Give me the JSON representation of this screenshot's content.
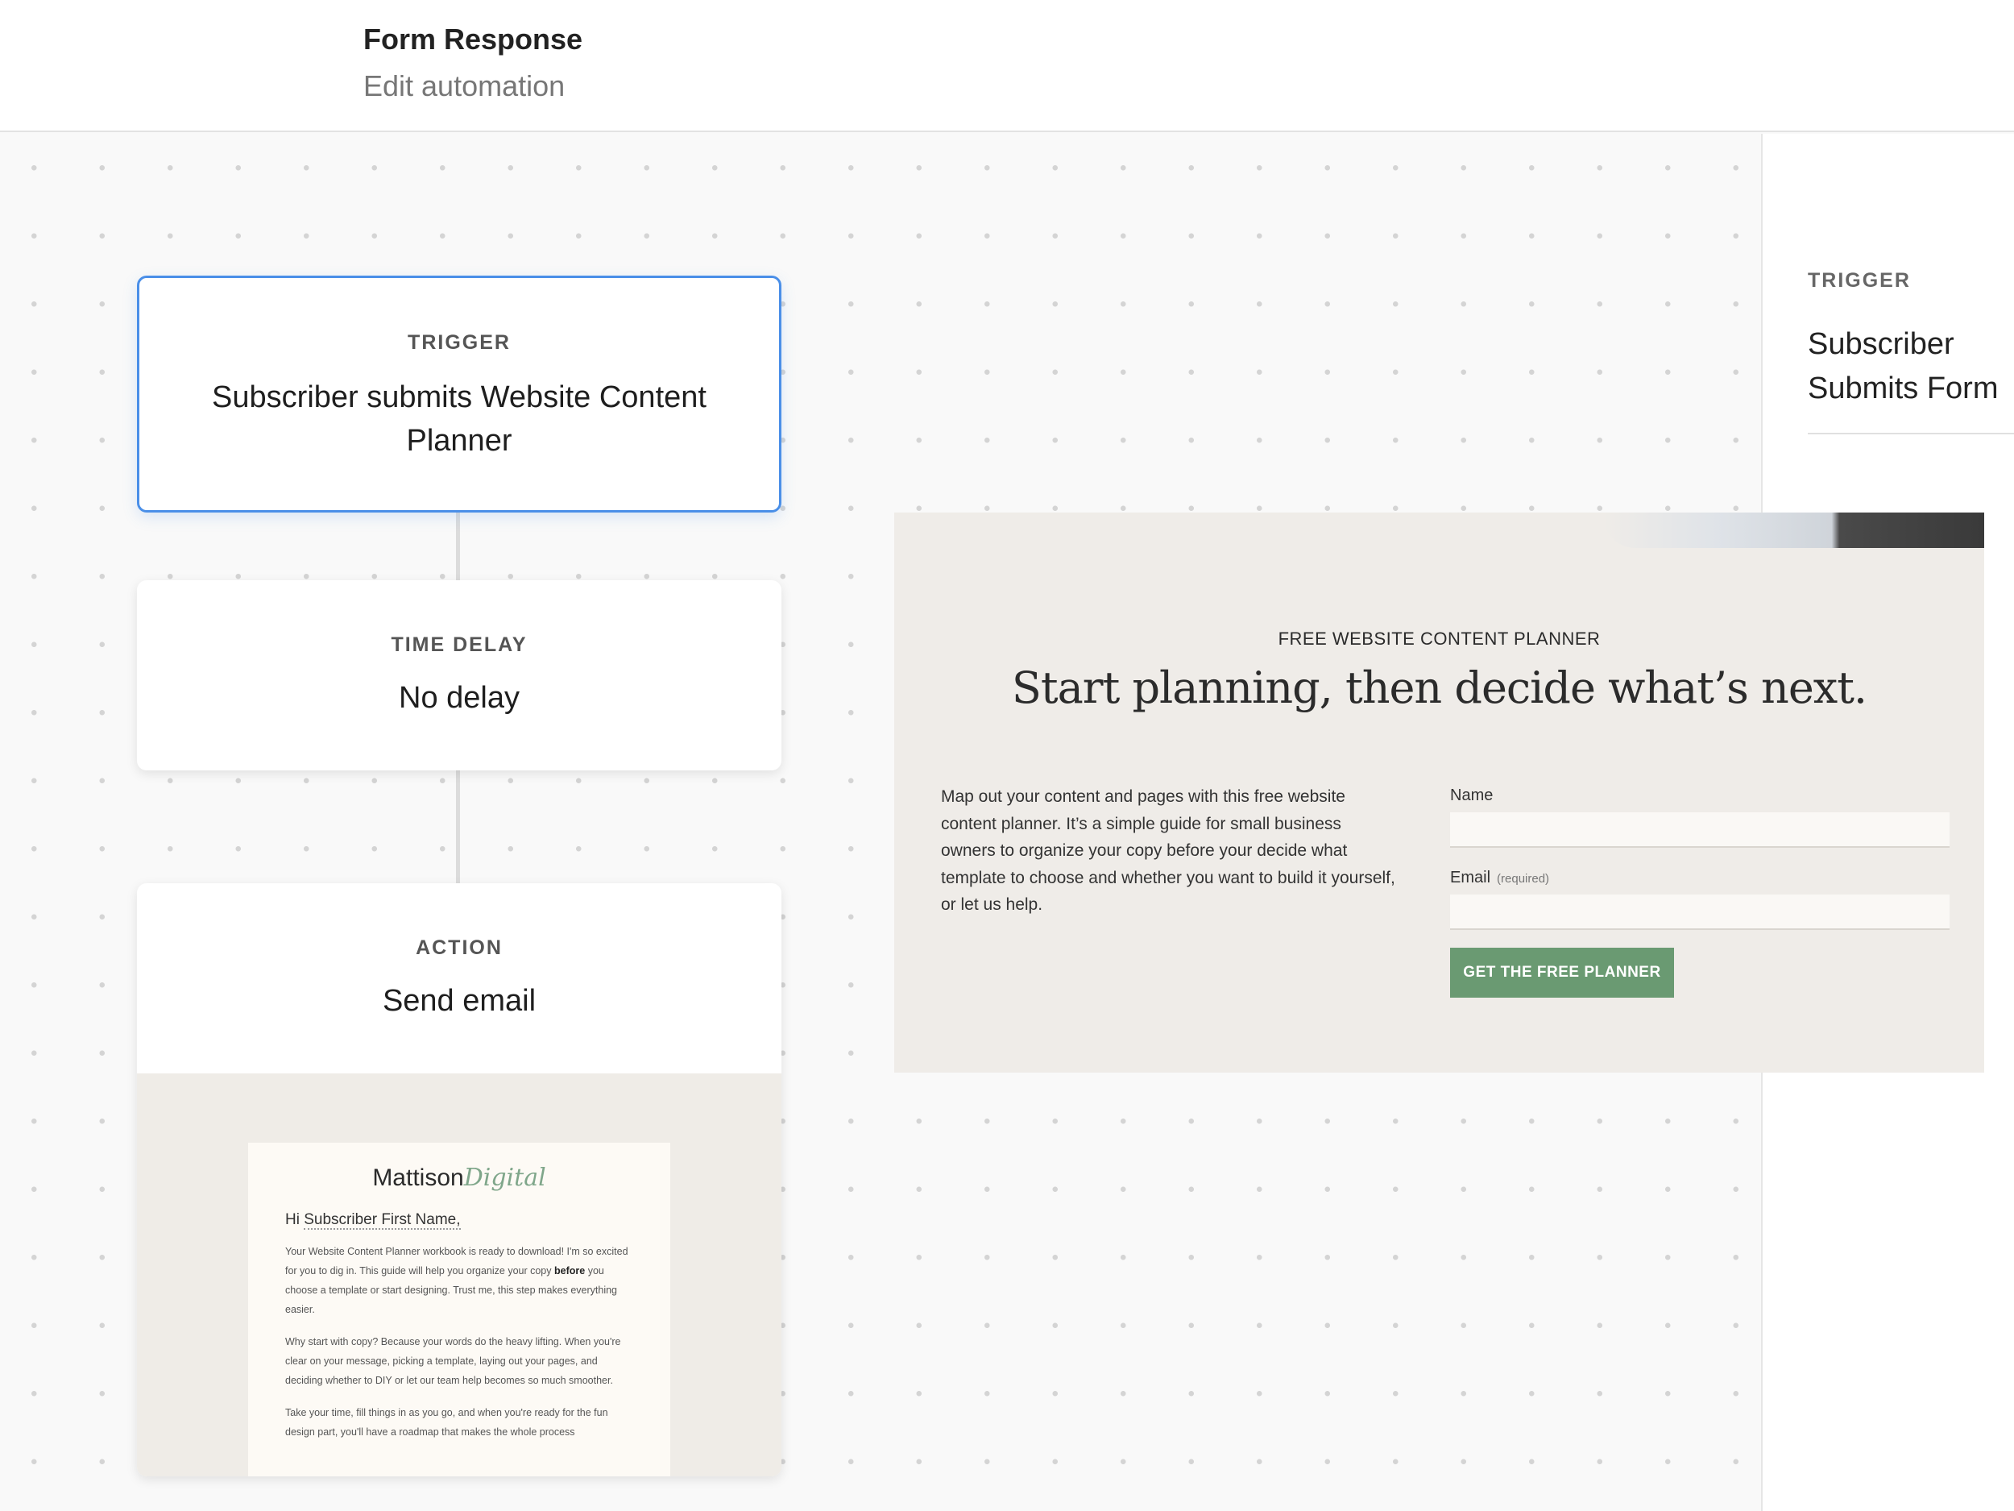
{
  "header": {
    "title": "Form Response",
    "subtitle": "Edit automation"
  },
  "workflow": {
    "trigger": {
      "label": "TRIGGER",
      "text": "Subscriber submits Website Content Planner"
    },
    "delay": {
      "label": "TIME DELAY",
      "text": "No delay"
    },
    "action": {
      "label": "ACTION",
      "text": "Send email",
      "email": {
        "logo_main": "Mattison",
        "logo_script": "Digital",
        "greeting_prefix": "Hi",
        "greeting_tag": "Subscriber First Name,",
        "p1_a": "Your Website Content Planner workbook is ready to download! I'm so excited for you to dig in. This guide will help you organize your copy",
        "p1_b": "before",
        "p1_c": "you choose a template or start designing. Trust me, this step makes everything easier.",
        "p2": "Why start with copy? Because your words do the heavy lifting. When you're clear on your message, picking a template, laying out your pages, and deciding whether to DIY or let our team help becomes so much smoother.",
        "p3": "Take your time, fill things in as you go, and when you're ready for the fun design part, you'll have a roadmap that makes the whole process"
      }
    }
  },
  "side_panel": {
    "label": "TRIGGER",
    "text": "Subscriber Submits Form"
  },
  "form_preview": {
    "eyebrow": "FREE WEBSITE CONTENT PLANNER",
    "headline": "Start planning, then decide what’s next.",
    "description": "Map out your content and pages with this free website content planner. It’s a simple guide for small business owners to organize your copy before your decide what template to choose and whether you want to build it yourself, or let us help.",
    "name_label": "Name",
    "email_label": "Email",
    "email_required": "(required)",
    "button": "GET THE FREE PLANNER"
  }
}
